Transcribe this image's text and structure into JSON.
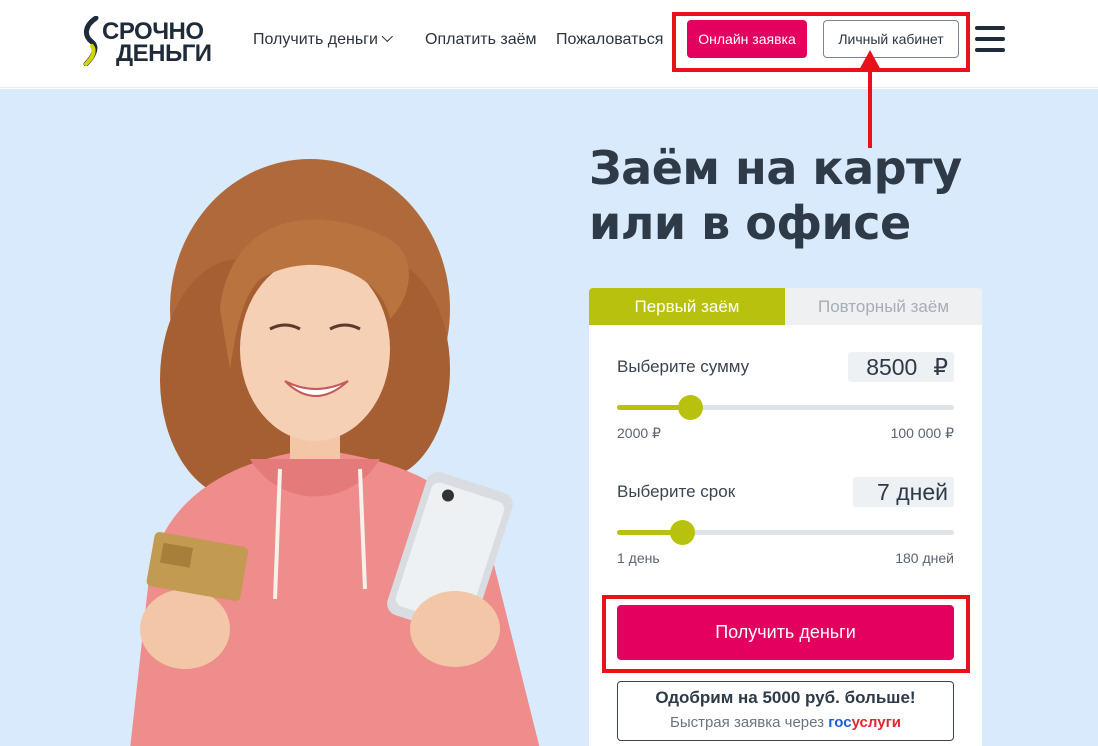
{
  "header": {
    "logo": {
      "line1": "СРОЧНО",
      "line2": "ДЕНЬГИ"
    },
    "nav": {
      "get_money": "Получить деньги",
      "pay_loan": "Оплатить заём",
      "complain": "Пожаловаться"
    },
    "online_request_label": "Онлайн заявка",
    "cabinet_label": "Личный кабинет",
    "menu_icon": "hamburger-icon"
  },
  "hero": {
    "title_line1": "Заём на карту",
    "title_line2": "или в офисе"
  },
  "calculator": {
    "tabs": [
      {
        "label": "Первый заём",
        "active": true
      },
      {
        "label": "Повторный заём",
        "active": false
      }
    ],
    "amount": {
      "label": "Выберите сумму",
      "value": "8500",
      "currency": "₽",
      "min_label": "2000 ₽",
      "max_label": "100 000 ₽",
      "min": 2000,
      "max": 100000,
      "current": 8500
    },
    "term": {
      "label": "Выберите срок",
      "value": "7 дней",
      "min_label": "1 день",
      "max_label": "180 дней",
      "min": 1,
      "max": 180,
      "current": 7
    },
    "submit_label": "Получить деньги",
    "promo": {
      "headline": "Одобрим на 5000 руб. больше!",
      "subline": "Быстрая заявка через",
      "gos_part1": "гос",
      "gos_part2": "услуги"
    }
  },
  "colors": {
    "accent_pink": "#e4005f",
    "accent_olive": "#b8c20e",
    "hero_bg": "#d8eafb",
    "highlight_red": "#e8121b"
  }
}
